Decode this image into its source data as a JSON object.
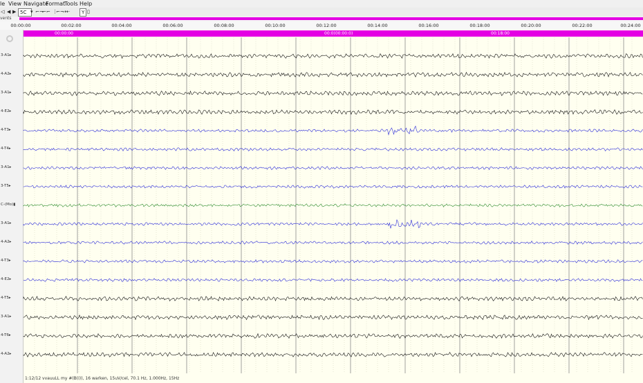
{
  "menu": {
    "file": "le",
    "view": "View",
    "navigate": "Navigate",
    "format": "Format",
    "tools": "Tools",
    "help": "Help"
  },
  "toolbar": {
    "speed_value": "5C",
    "y_label": "Y"
  },
  "events_label": "vents",
  "ruler_ticks": [
    "00:00:00",
    "00:02:00",
    "00:04:00",
    "00:06:00",
    "00:08:00",
    "00:10:00",
    "00:12:00",
    "00:14:00",
    "00:16:00",
    "00:18:00",
    "00:20:00",
    "00:22:00",
    "00:24:00"
  ],
  "segments": [
    "00:00:00",
    "00:0(00:00:0)",
    "00:18:00"
  ],
  "channels": [
    {
      "label": "3-A1▸",
      "color": "#111111"
    },
    {
      "label": "4-A2▸",
      "color": "#111111"
    },
    {
      "label": "3-A1▸",
      "color": "#111111"
    },
    {
      "label": "4-E2▸",
      "color": "#111111"
    },
    {
      "label": "4-T3▸",
      "color": "#2a2ad8"
    },
    {
      "label": "4-T4▸",
      "color": "#2a2ad8"
    },
    {
      "label": "3-A1▸",
      "color": "#2a2ad8"
    },
    {
      "label": "3-T5▸",
      "color": "#2a2ad8"
    },
    {
      "label": "C-(Mo)▮",
      "color": "#2a8a2a"
    },
    {
      "label": "3-A1▸",
      "color": "#2a2ad8"
    },
    {
      "label": "4-A2▸",
      "color": "#2a2ad8"
    },
    {
      "label": "4-T3▸",
      "color": "#2a2ad8"
    },
    {
      "label": "4-E2▸",
      "color": "#2a2ad8"
    },
    {
      "label": "4-T5▸",
      "color": "#111111"
    },
    {
      "label": "3-A1▸",
      "color": "#111111"
    },
    {
      "label": "4-T6▸",
      "color": "#111111"
    },
    {
      "label": "4-A2▸",
      "color": "#111111"
    }
  ],
  "status_line": "1:12/12 vvauuLL my #(B(I)), 16 warken, 15uV/cel, 70.1 Hz, 1.000Hz, 15Hz"
}
